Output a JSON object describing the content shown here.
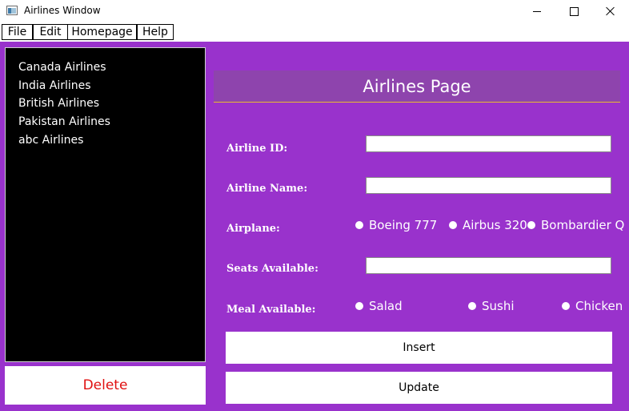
{
  "window": {
    "title": "Airlines Window",
    "app_icon": "window-app-icon",
    "controls": {
      "minimize_icon": "minimize-icon",
      "maximize_icon": "maximize-icon",
      "close_icon": "close-icon"
    },
    "background_color": "#9932CC"
  },
  "menu": {
    "items": [
      {
        "label": "File"
      },
      {
        "label": "Edit"
      },
      {
        "label": "Homepage"
      },
      {
        "label": "Help"
      }
    ]
  },
  "airline_list": {
    "items": [
      {
        "label": "Canada Airlines"
      },
      {
        "label": "India Airlines"
      },
      {
        "label": "British Airlines"
      },
      {
        "label": "Pakistan Airlines"
      },
      {
        "label": "abc Airlines"
      }
    ]
  },
  "delete_button": {
    "label": "Delete",
    "color": "#e01010"
  },
  "page_header": {
    "title": "Airlines Page"
  },
  "form": {
    "airline_id": {
      "label": "Airline ID:",
      "value": ""
    },
    "airline_name": {
      "label": "Airline Name:",
      "value": ""
    },
    "airplane": {
      "label": "Airplane:",
      "options": [
        {
          "label": "Boeing 777"
        },
        {
          "label": "Airbus 320"
        },
        {
          "label": "Bombardier Q"
        }
      ]
    },
    "seats_available": {
      "label": "Seats Available:",
      "value": ""
    },
    "meal_available": {
      "label": "Meal Available:",
      "options": [
        {
          "label": "Salad"
        },
        {
          "label": "Sushi"
        },
        {
          "label": "Chicken"
        }
      ]
    }
  },
  "buttons": {
    "insert": {
      "label": "Insert"
    },
    "update": {
      "label": "Update"
    }
  }
}
